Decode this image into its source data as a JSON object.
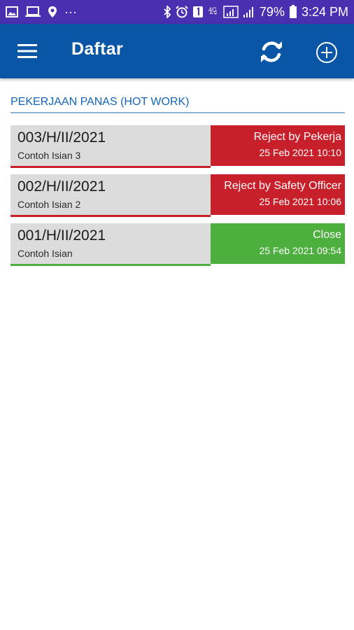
{
  "status_bar": {
    "battery": "79%",
    "time": "3:24 PM",
    "dots": "···",
    "network": "4G"
  },
  "app_bar": {
    "title": "Daftar"
  },
  "section": {
    "title": "PEKERJAAN PANAS (HOT WORK)"
  },
  "items": [
    {
      "id": "003/H/II/2021",
      "desc": "Contoh Isian 3",
      "status": "Reject by Pekerja",
      "date": "25 Feb 2021 10:10",
      "color": "#c8202b"
    },
    {
      "id": "002/H/II/2021",
      "desc": "Contoh Isian 2",
      "status": "Reject by Safety Officer",
      "date": "25 Feb 2021 10:06",
      "color": "#c8202b"
    },
    {
      "id": "001/H/II/2021",
      "desc": "Contoh Isian",
      "status": "Close",
      "date": "25 Feb 2021 09:54",
      "color": "#4caf3e"
    }
  ],
  "colors": {
    "status_bar": "#4a2fb0",
    "app_bar": "#0a56a6",
    "section_title": "#1565b8"
  }
}
